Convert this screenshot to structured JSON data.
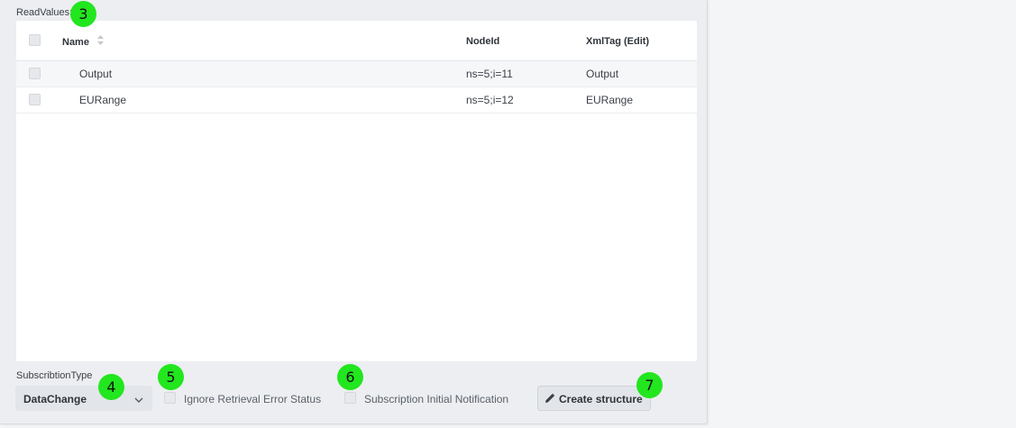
{
  "read_values": {
    "label": "ReadValues:",
    "columns": {
      "name": "Name",
      "node_id": "NodeId",
      "xml_tag": "XmlTag (Edit)"
    },
    "rows": [
      {
        "name": "Output",
        "node_id": "ns=5;i=11",
        "xml_tag": "Output"
      },
      {
        "name": "EURange",
        "node_id": "ns=5;i=12",
        "xml_tag": "EURange"
      }
    ]
  },
  "subscription": {
    "label": "SubscribtionType",
    "selected": "DataChange"
  },
  "options": {
    "ignore_retrieval_error_status": {
      "label": "Ignore Retrieval Error Status",
      "checked": false
    },
    "subscription_initial_notification": {
      "label": "Subscription Initial Notification",
      "checked": false
    }
  },
  "actions": {
    "create_structure": "Create structure"
  },
  "markers": [
    "3",
    "4",
    "5",
    "6",
    "7"
  ],
  "colors": {
    "marker": "#22e61e",
    "panel": "#eceef1"
  }
}
